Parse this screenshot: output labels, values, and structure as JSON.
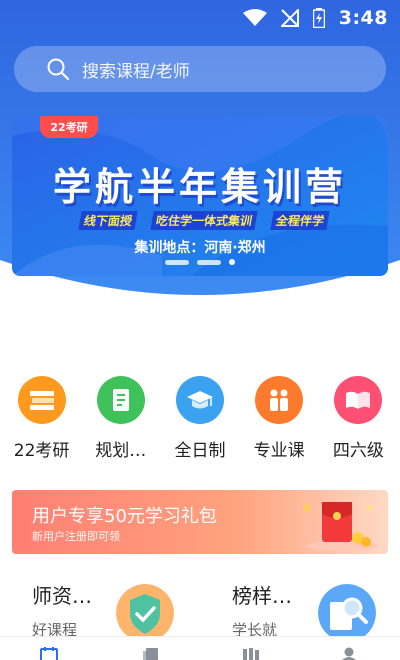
{
  "status_bar": {
    "time": "3:48"
  },
  "search": {
    "placeholder": "搜索课程/老师"
  },
  "banner": {
    "tag": "22考研",
    "title": "学航半年集训营",
    "subtitles": [
      "线下面授",
      "吃住学一体式集训",
      "全程伴学"
    ],
    "location": "集训地点：河南·郑州",
    "slides": 3,
    "active_slide": 3
  },
  "categories": [
    {
      "label": "22考研",
      "icon": "book-stack-icon",
      "color": "#ff9a1f"
    },
    {
      "label": "规划…",
      "icon": "plan-doc-icon",
      "color": "#3fc25a"
    },
    {
      "label": "全日制",
      "icon": "graduation-cap-icon",
      "color": "#3aa2ef"
    },
    {
      "label": "专业课",
      "icon": "people-icon",
      "color": "#ff7a2d"
    },
    {
      "label": "四六级",
      "icon": "open-book-icon",
      "color": "#ff4f73"
    }
  ],
  "promo": {
    "title": "用户专享50元学习礼包",
    "subtitle": "新用户注册即可领"
  },
  "features": [
    {
      "title": "师资…",
      "subtitle": "好课程",
      "icon": "teacher-shield-icon"
    },
    {
      "title": "榜样…",
      "subtitle": "学长就",
      "icon": "magnifier-icon"
    }
  ],
  "bottom_nav": [
    "calendar-icon",
    "notes-icon",
    "books-icon",
    "profile-icon"
  ],
  "colors": {
    "primary": "#2f6fe6",
    "accent": "#ff4c4c"
  }
}
